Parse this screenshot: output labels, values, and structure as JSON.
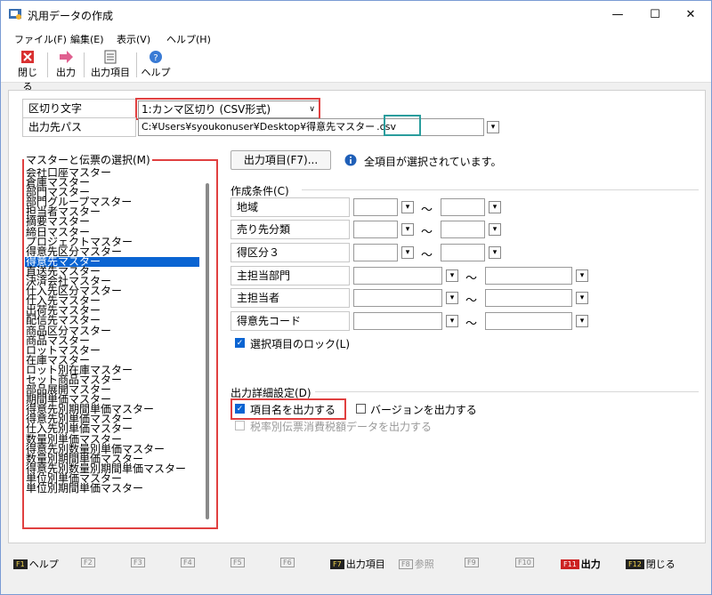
{
  "window": {
    "title": "汎用データの作成",
    "minimize": "—",
    "maximize": "☐",
    "close": "✕"
  },
  "menu": [
    "ファイル(F)",
    "編集(E)",
    "表示(V)",
    "ヘルプ(H)"
  ],
  "toolbar": {
    "close": "閉じる",
    "output": "出力",
    "output_items": "出力項目",
    "help": "ヘルプ"
  },
  "fields": {
    "delimiter_label": "区切り文字",
    "delimiter_value": "1:カンマ区切り (CSV形式)",
    "dest_label": "出力先パス",
    "dest_value": "C:¥Users¥syoukonuser¥Desktop¥得意先マスター",
    "dest_ext": ".csv"
  },
  "list_group_title": "マスターと伝票の選択(M)",
  "master_list": [
    "会社口座マスター",
    "倉庫マスター",
    "部門マスター",
    "部門グループマスター",
    "担当者マスター",
    "摘要マスター",
    "締日マスター",
    "プロジェクトマスター",
    "得意先区分マスター",
    "得意先マスター",
    "直送先マスター",
    "決済会社マスター",
    "仕入先区分マスター",
    "仕入先マスター",
    "出荷先マスター",
    "配信先マスター",
    "商品区分マスター",
    "商品マスター",
    "ロットマスター",
    "在庫マスター",
    "ロット別在庫マスター",
    "セット商品マスター",
    "部品展開マスター",
    "期間単価マスター",
    "得意先別期間単価マスター",
    "得意先別単価マスター",
    "仕入先別単価マスター",
    "数量別単価マスター",
    "得意先別数量別単価マスター",
    "数量別期間単価マスター",
    "得意先別数量別期間単価マスター",
    "単位別単価マスター",
    "単位別期間単価マスター"
  ],
  "selected_index": 9,
  "output_items_button": "出力項目(F7)...",
  "info_text": "全項目が選択されています。",
  "conditions_title": "作成条件(C)",
  "conditions": [
    "地域",
    "売り先分類",
    "得区分３",
    "主担当部門",
    "主担当者",
    "得意先コード"
  ],
  "range_sep": "～",
  "lock_label": "選択項目のロック(L)",
  "output_settings_title": "出力詳細設定(D)",
  "opt_item_name": "項目名を出力する",
  "opt_version": "バージョンを出力する",
  "opt_tax": "税率別伝票消費税額データを出力する",
  "fkeys": [
    {
      "key": "F1",
      "label": "ヘルプ"
    },
    {
      "key": "F2",
      "label": ""
    },
    {
      "key": "F3",
      "label": ""
    },
    {
      "key": "F4",
      "label": ""
    },
    {
      "key": "F5",
      "label": ""
    },
    {
      "key": "F6",
      "label": ""
    },
    {
      "key": "F7",
      "label": "出力項目"
    },
    {
      "key": "F8",
      "label": "参照"
    },
    {
      "key": "F9",
      "label": ""
    },
    {
      "key": "F10",
      "label": ""
    },
    {
      "key": "F11",
      "label": "出力"
    },
    {
      "key": "F12",
      "label": "閉じる"
    }
  ],
  "colors": {
    "selection": "#0a64d2",
    "highlight_red": "#e04040",
    "highlight_teal": "#2a9d9d"
  }
}
